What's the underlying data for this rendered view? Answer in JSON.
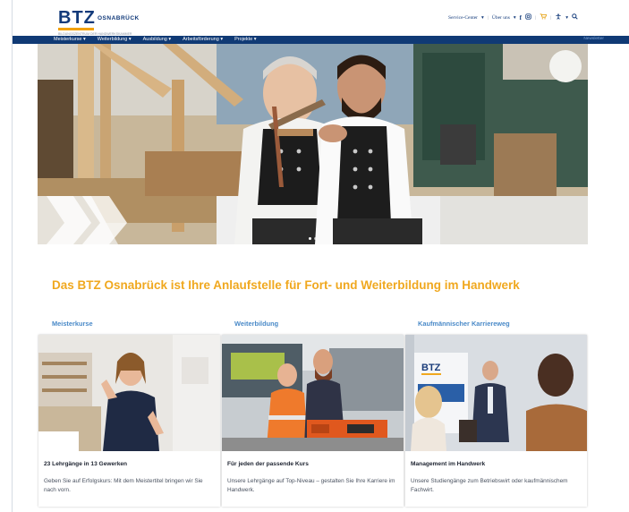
{
  "brand": {
    "logo_text": "BTZ",
    "city": "OSNABRÜCK",
    "tagline": "BILDUNGSZENTRUM DER HANDWERKSKAMMER",
    "accent_color": "#f0a81f",
    "primary_color": "#103a75"
  },
  "utility": {
    "service_center": "Service-Center",
    "about": "Über uns",
    "chevron": "▾",
    "sep": "|",
    "icons": [
      "facebook-icon",
      "instagram-icon",
      "cart-icon",
      "accessibility-icon",
      "search-icon"
    ]
  },
  "nav": {
    "items": [
      "Meisterkurse ▾",
      "Weiterbildung ▾",
      "Ausbildung ▾",
      "Arbeitsförderung ▾",
      "Projekte ▾"
    ],
    "right": "Newsletter"
  },
  "hero": {
    "slides": 2,
    "active_slide": 1
  },
  "headline": "Das BTZ Osnabrück ist Ihre Anlaufstelle für Fort- und Weiterbildung im Handwerk",
  "columns": [
    {
      "title": "Meisterkurse",
      "heading": "23 Lehrgänge in 13 Gewerken",
      "text": "Geben Sie auf Erfolgskurs: Mit dem Meistertitel bringen wir Sie nach vorn."
    },
    {
      "title": "Weiterbildung",
      "heading": "Für jeden der passende Kurs",
      "text": "Unsere Lehrgänge auf Top-Niveau – gestalten Sie Ihre Karriere im Handwerk."
    },
    {
      "title": "Kaufmännischer Karriereweg",
      "heading": "Management im Handwerk",
      "text": "Unsere Studiengänge zum Betriebswirt oder kaufmännischem Fachwirt."
    }
  ],
  "card3_sign": "BTZ"
}
